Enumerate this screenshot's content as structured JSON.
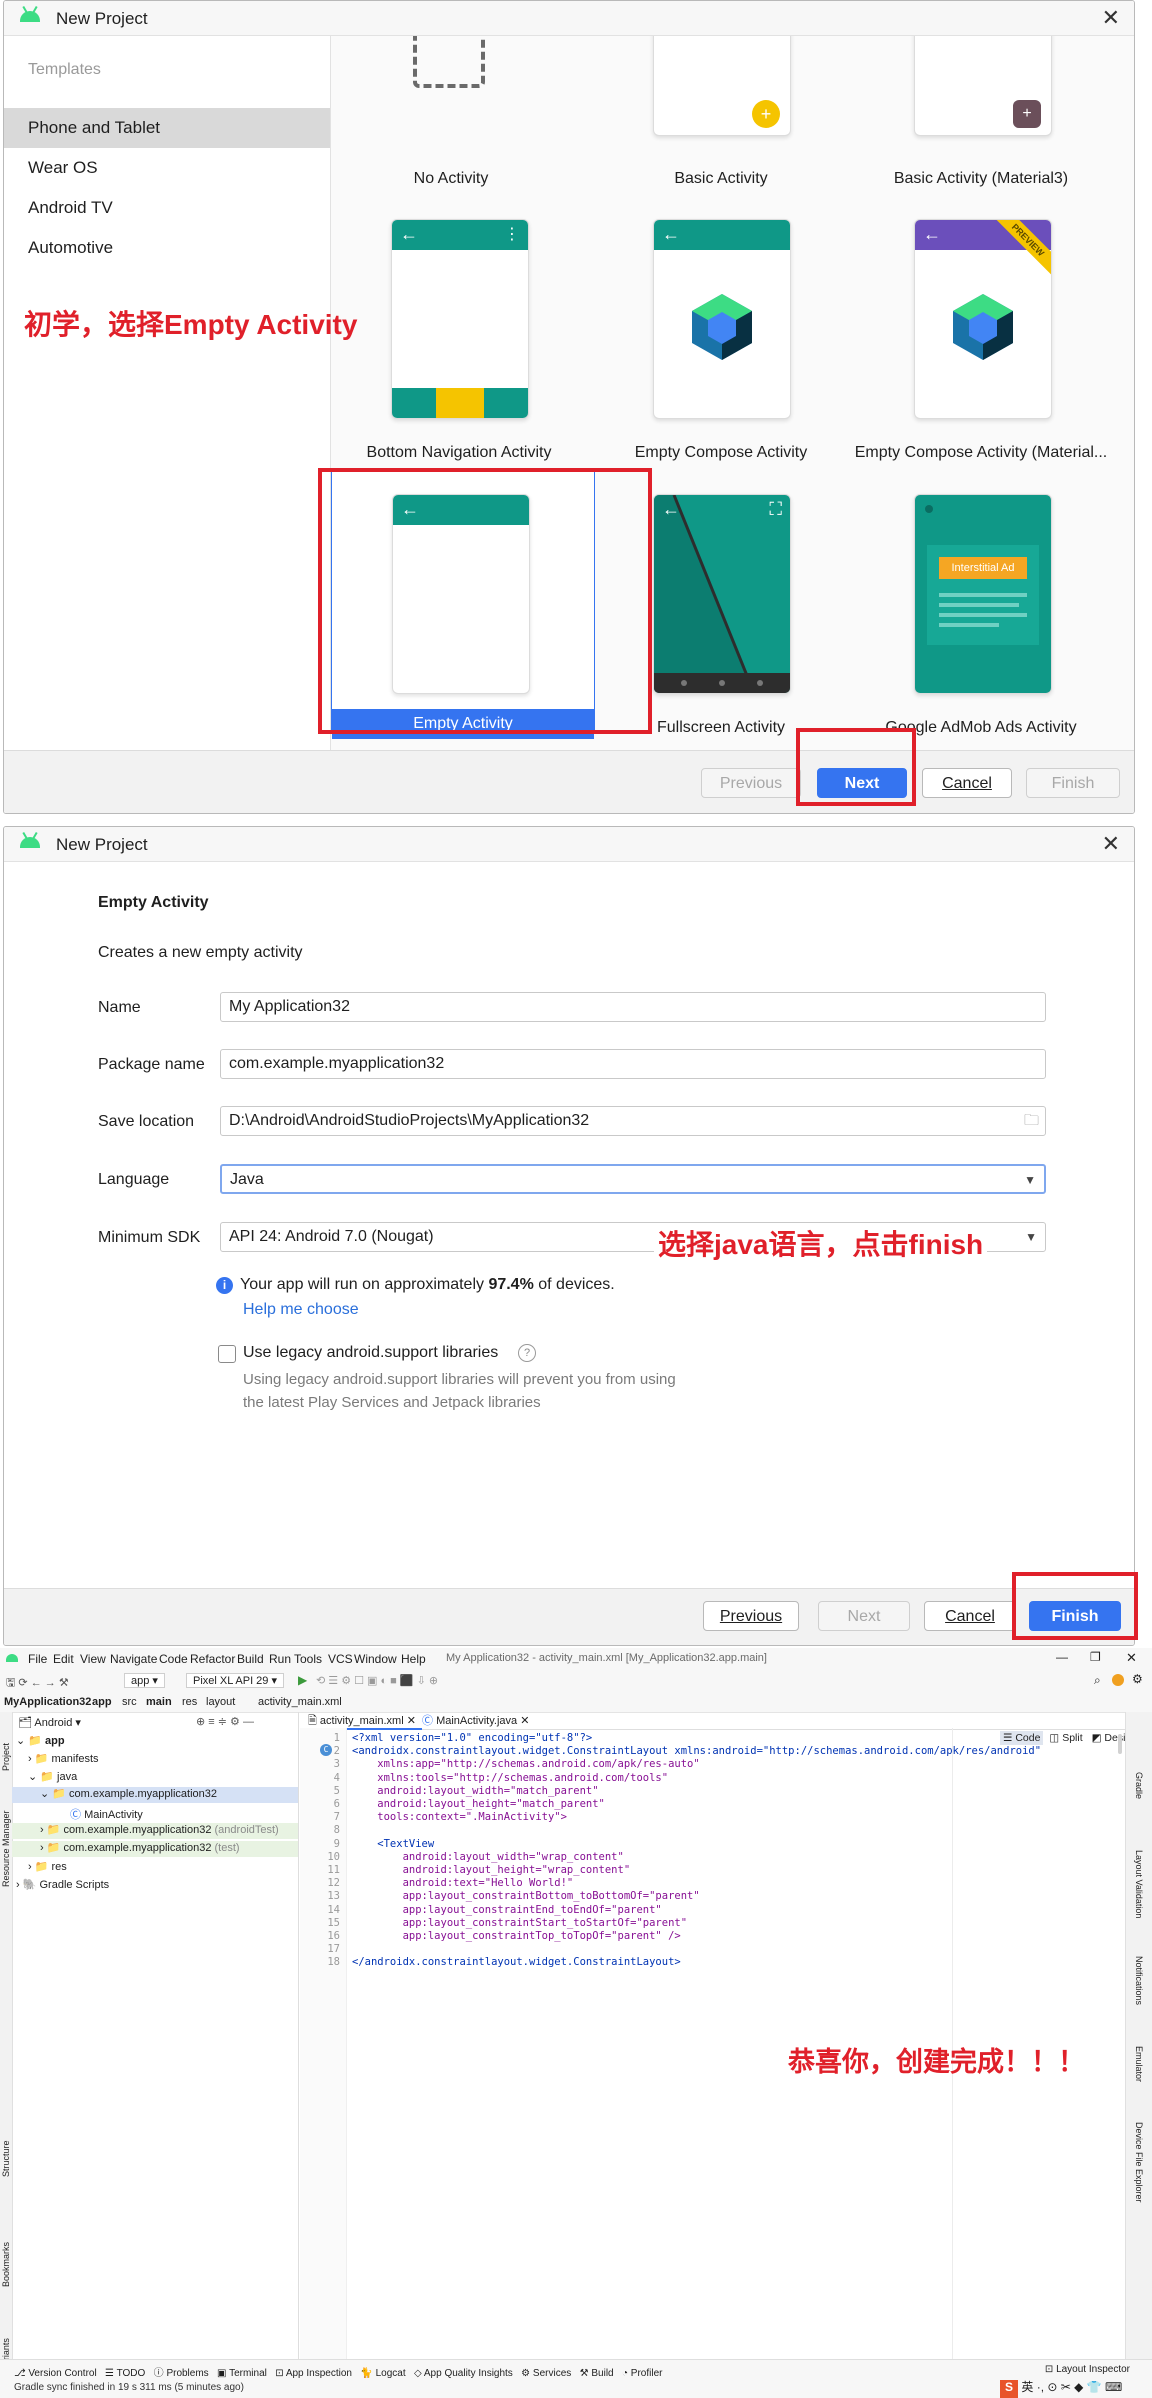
{
  "dialog1": {
    "title": "New Project",
    "sidebar_header": "Templates",
    "sidebar_items": [
      "Phone and Tablet",
      "Wear OS",
      "Android TV",
      "Automotive"
    ],
    "templates": [
      "No Activity",
      "Basic Activity",
      "Basic Activity (Material3)",
      "Bottom Navigation Activity",
      "Empty Compose Activity",
      "Empty Compose Activity (Material...",
      "Empty Activity",
      "Fullscreen Activity",
      "Google AdMob Ads Activity"
    ],
    "preview_badge": "PREVIEW",
    "interstitial_ad": "Interstitial Ad",
    "annotation": "初学，选择Empty Activity",
    "buttons": {
      "previous": "Previous",
      "next": "Next",
      "cancel": "Cancel",
      "finish": "Finish"
    }
  },
  "dialog2": {
    "title": "New Project",
    "heading": "Empty Activity",
    "subtitle": "Creates a new empty activity",
    "fields": {
      "name_label": "Name",
      "name_value": "My Application32",
      "package_label": "Package name",
      "package_value": "com.example.myapplication32",
      "save_label": "Save location",
      "save_value": "D:\\Android\\AndroidStudioProjects\\MyApplication32",
      "language_label": "Language",
      "language_value": "Java",
      "sdk_label": "Minimum SDK",
      "sdk_value": "API 24: Android 7.0 (Nougat)"
    },
    "info_prefix": "Your app will run on approximately ",
    "info_pct": "97.4%",
    "info_suffix": " of devices.",
    "help_link": "Help me choose",
    "legacy_label": "Use legacy android.support libraries",
    "legacy_desc1": "Using legacy android.support libraries will prevent you from using",
    "legacy_desc2": "the latest Play Services and Jetpack libraries",
    "annotation": "选择java语言，点击finish",
    "buttons": {
      "previous": "Previous",
      "next": "Next",
      "cancel": "Cancel",
      "finish": "Finish"
    }
  },
  "ide": {
    "menu": [
      "File",
      "Edit",
      "View",
      "Navigate",
      "Code",
      "Refactor",
      "Build",
      "Run",
      "Tools",
      "VCS",
      "Window",
      "Help"
    ],
    "window_title": "My Application32 - activity_main.xml [My_Application32.app.main]",
    "run_config": "app",
    "device": "Pixel XL API 29",
    "breadcrumbs": [
      "MyApplication32",
      "app",
      "src",
      "main",
      "res",
      "layout",
      "activity_main.xml"
    ],
    "project_view": "Android",
    "tree": [
      {
        "label": "app",
        "depth": 0
      },
      {
        "label": "manifests",
        "depth": 1
      },
      {
        "label": "java",
        "depth": 1
      },
      {
        "label": "com.example.myapplication32",
        "depth": 2
      },
      {
        "label": "MainActivity",
        "depth": 3
      },
      {
        "label": "com.example.myapplication32",
        "suffix": "(androidTest)",
        "depth": 2
      },
      {
        "label": "com.example.myapplication32",
        "suffix": "(test)",
        "depth": 2
      },
      {
        "label": "res",
        "depth": 1
      },
      {
        "label": "Gradle Scripts",
        "depth": 0
      }
    ],
    "editor_tabs": [
      "activity_main.xml",
      "MainActivity.java"
    ],
    "view_modes": [
      "Code",
      "Split",
      "Design"
    ],
    "code_lines": [
      "<?xml version=\"1.0\" encoding=\"utf-8\"?>",
      "<androidx.constraintlayout.widget.ConstraintLayout xmlns:android=\"http://schemas.android.com/apk/res/android\"",
      "    xmlns:app=\"http://schemas.android.com/apk/res-auto\"",
      "    xmlns:tools=\"http://schemas.android.com/tools\"",
      "    android:layout_width=\"match_parent\"",
      "    android:layout_height=\"match_parent\"",
      "    tools:context=\".MainActivity\">",
      "",
      "    <TextView",
      "        android:layout_width=\"wrap_content\"",
      "        android:layout_height=\"wrap_content\"",
      "        android:text=\"Hello World!\"",
      "        app:layout_constraintBottom_toBottomOf=\"parent\"",
      "        app:layout_constraintEnd_toEndOf=\"parent\"",
      "        app:layout_constraintStart_toStartOf=\"parent\"",
      "        app:layout_constraintTop_toTopOf=\"parent\" />",
      "",
      "</androidx.constraintlayout.widget.ConstraintLayout>"
    ],
    "annotation": "恭喜你，创建完成！！！",
    "left_strip": [
      "Project",
      "Resource Manager",
      "Structure",
      "Bookmarks",
      "Build Variants"
    ],
    "right_strip": [
      "Gradle",
      "Layout Validation",
      "Notifications",
      "Emulator",
      "Device File Explorer"
    ],
    "bottom_tools": [
      "Version Control",
      "TODO",
      "Problems",
      "Terminal",
      "App Inspection",
      "Logcat",
      "App Quality Insights",
      "Services",
      "Build",
      "Profiler"
    ],
    "layout_inspector": "Layout Inspector",
    "status": "Gradle sync finished in 19 s 311 ms (5 minutes ago)",
    "ime": "英"
  },
  "colors": {
    "accent": "#3574f0",
    "annotation_red": "#e0202a",
    "teal": "#0f9887",
    "material_purple": "#6b4fbb"
  }
}
